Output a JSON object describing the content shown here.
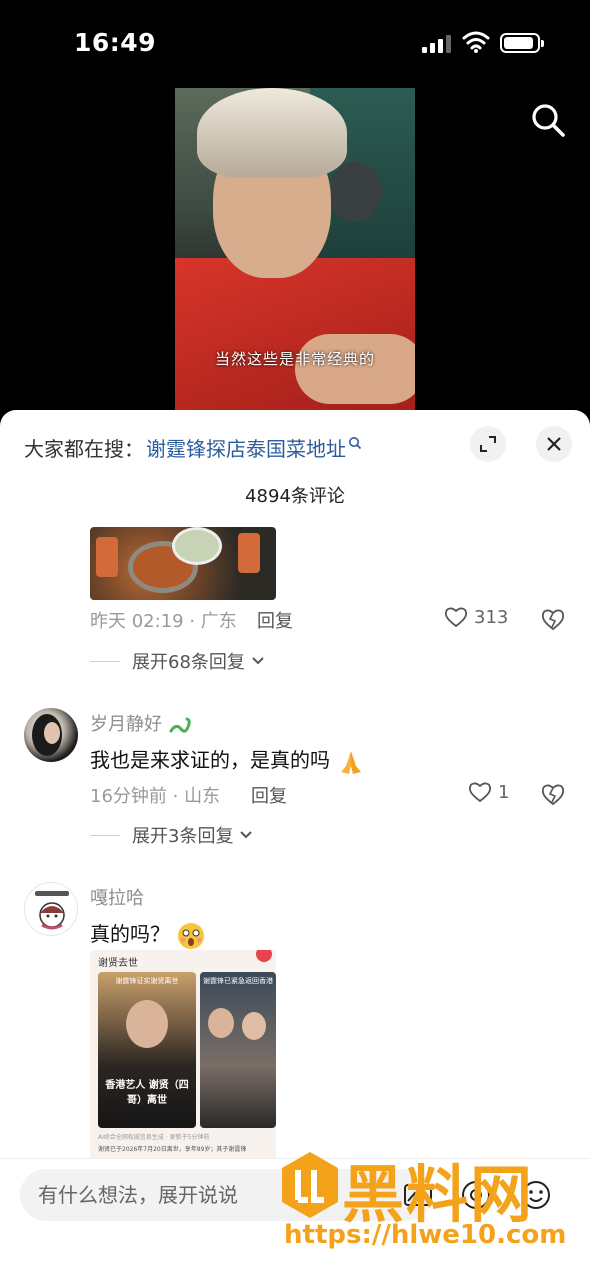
{
  "status_bar": {
    "time": "16:49"
  },
  "video": {
    "subtitle": "当然这些是非常经典的"
  },
  "comments_sheet": {
    "search_prefix": "大家都在搜：",
    "search_link": "谢霆锋探店泰国菜地址",
    "comment_count": "4894条评论"
  },
  "comment_top": {
    "time_loc": "昨天 02:19 · 广东",
    "reply_label": "回复",
    "likes": "313",
    "expand_label": "展开68条回复"
  },
  "comment_1": {
    "user": "岁月静好",
    "text": "我也是来求证的，是真的吗",
    "time_loc": "16分钟前 · 山东",
    "reply_label": "回复",
    "likes": "1",
    "expand_label": "展开3条回复"
  },
  "comment_2": {
    "user": "嘎拉哈",
    "text": "真的吗？",
    "image_title": "谢贤去世",
    "card1_caption": "香港艺人 谢贤（四哥）离世",
    "card_tag_left": "谢霆锋证实谢贤离世",
    "card_tag_right": "谢霆锋已紧急返回香港",
    "image_source": "AI综合全网权威信息生成 · 更新于5分钟前",
    "image_body": "谢贤已于2026年7月20日离世，享年89岁；其子谢霆锋"
  },
  "input_bar": {
    "placeholder": "有什么想法，展开说说"
  },
  "watermark": {
    "brand": "黑料网",
    "url": "https://hlwe10.com"
  },
  "colors": {
    "link": "#2d5d9e",
    "watermark": "#f3a219"
  }
}
